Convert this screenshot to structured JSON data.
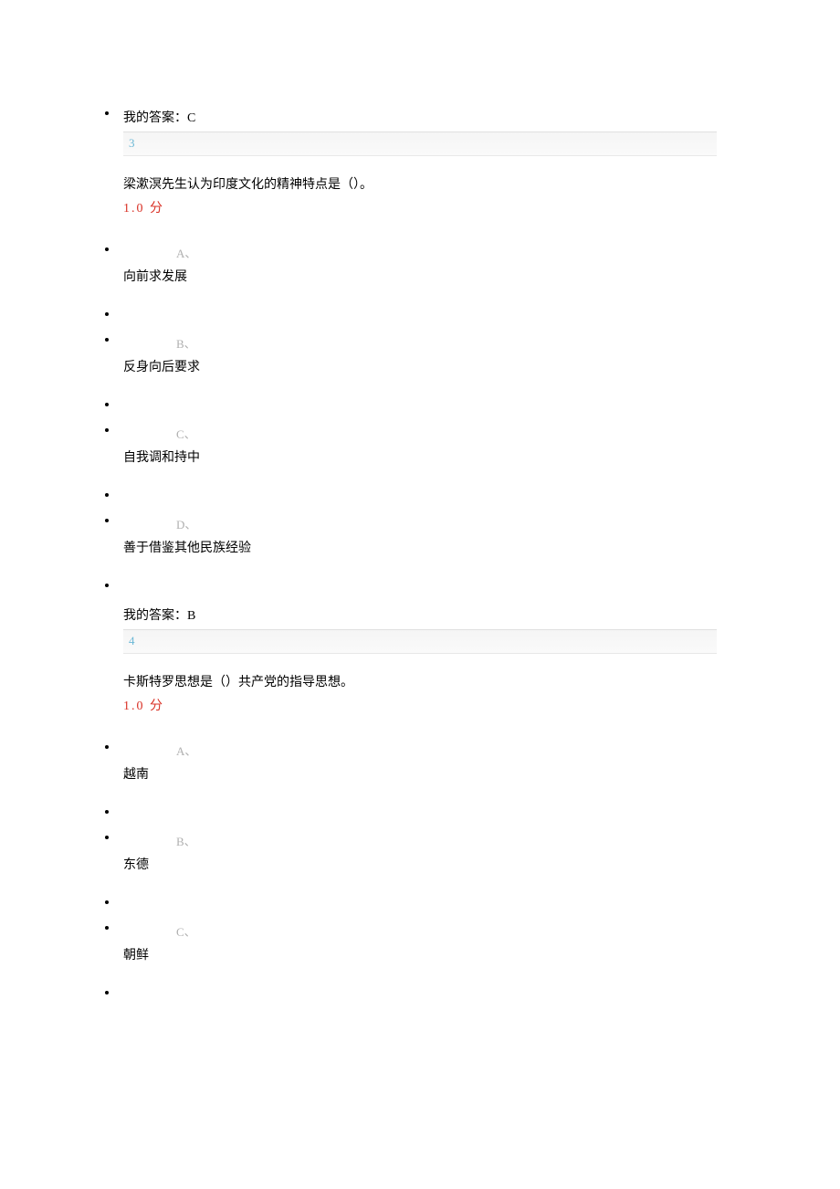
{
  "q2": {
    "myAnswerLabel": "我的答案：C"
  },
  "q3": {
    "number": "3",
    "question": "梁漱溟先生认为印度文化的精神特点是（）。",
    "score": "1.0  分",
    "options": {
      "a": {
        "letter": "A、",
        "text": "向前求发展"
      },
      "b": {
        "letter": "B、",
        "text": "反身向后要求"
      },
      "c": {
        "letter": "C、",
        "text": "自我调和持中"
      },
      "d": {
        "letter": "D、",
        "text": "善于借鉴其他民族经验"
      }
    },
    "myAnswerLabel": "我的答案：B"
  },
  "q4": {
    "number": "4",
    "question": "卡斯特罗思想是（）共产党的指导思想。",
    "score": "1.0  分",
    "options": {
      "a": {
        "letter": "A、",
        "text": "越南"
      },
      "b": {
        "letter": "B、",
        "text": "东德"
      },
      "c": {
        "letter": "C、",
        "text": "朝鲜"
      }
    }
  }
}
